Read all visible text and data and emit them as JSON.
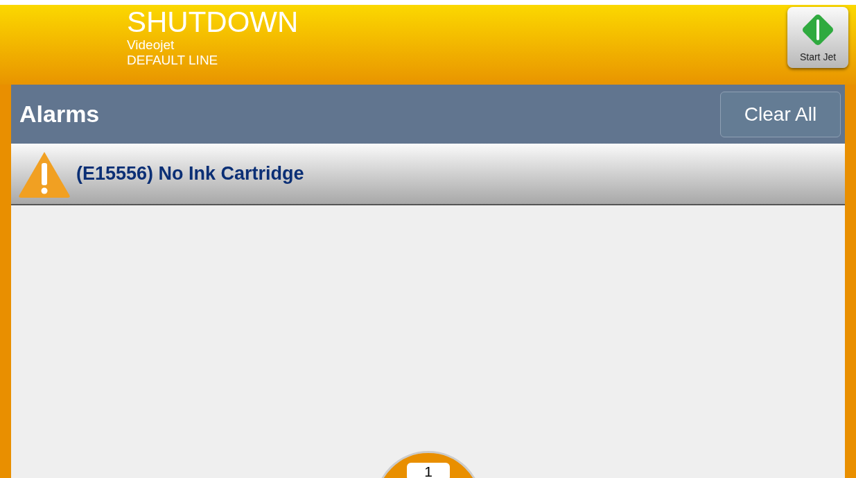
{
  "header": {
    "status": "SHUTDOWN",
    "printer": "Videojet",
    "line": "DEFAULT LINE",
    "start_button": {
      "label": "Start Jet"
    }
  },
  "alarms_panel": {
    "title": "Alarms",
    "clear_button": "Clear All",
    "alarms": [
      {
        "text": "(E15556) No Ink Cartridge"
      }
    ]
  },
  "page_badge": "1"
}
